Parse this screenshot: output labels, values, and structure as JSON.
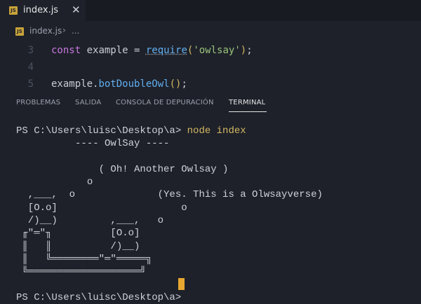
{
  "tab": {
    "badge": "JS",
    "title": "index.js",
    "close": "✕"
  },
  "breadcrumb": {
    "badge": "JS",
    "file": "index.js",
    "separator": "›",
    "more": "..."
  },
  "editor": {
    "lines": [
      {
        "number": "3",
        "const": "const",
        "name": " example = ",
        "require": "require",
        "open": "(",
        "string": "'owlsay'",
        "close": ")",
        "end": ";"
      },
      {
        "number": "4"
      },
      {
        "number": "5",
        "obj": "example.",
        "method": "botDoubleOwl",
        "parens": "()",
        "end": ";"
      }
    ]
  },
  "panel": {
    "tabs": [
      "PROBLEMAS",
      "SALIDA",
      "CONSOLA DE DEPURACIÓN",
      "TERMINAL"
    ],
    "active_tab": "TERMINAL"
  },
  "terminal": {
    "prompt": "PS C:\\Users\\luisc\\Desktop\\a> ",
    "command": "node index",
    "output": "          ---- OwlSay ----\n\n              ( Oh! Another Owlsay )\n            o\n  ,___,  o              (Yes. This is a Olwsayverse)\n  [O.o]                     o\n  /)__)         ,___,   o\n ╓\"═\"╖          [O.o]\n ║   ║          /)__)\n ║   ╚════════\"═\"═════╗\n ╚═══════════════════╝",
    "final_prompt": "PS C:\\Users\\luisc\\Desktop\\a>"
  },
  "colors": {
    "background": "#1e212a",
    "cursor": "#e8a830",
    "command": "#d4b862"
  }
}
